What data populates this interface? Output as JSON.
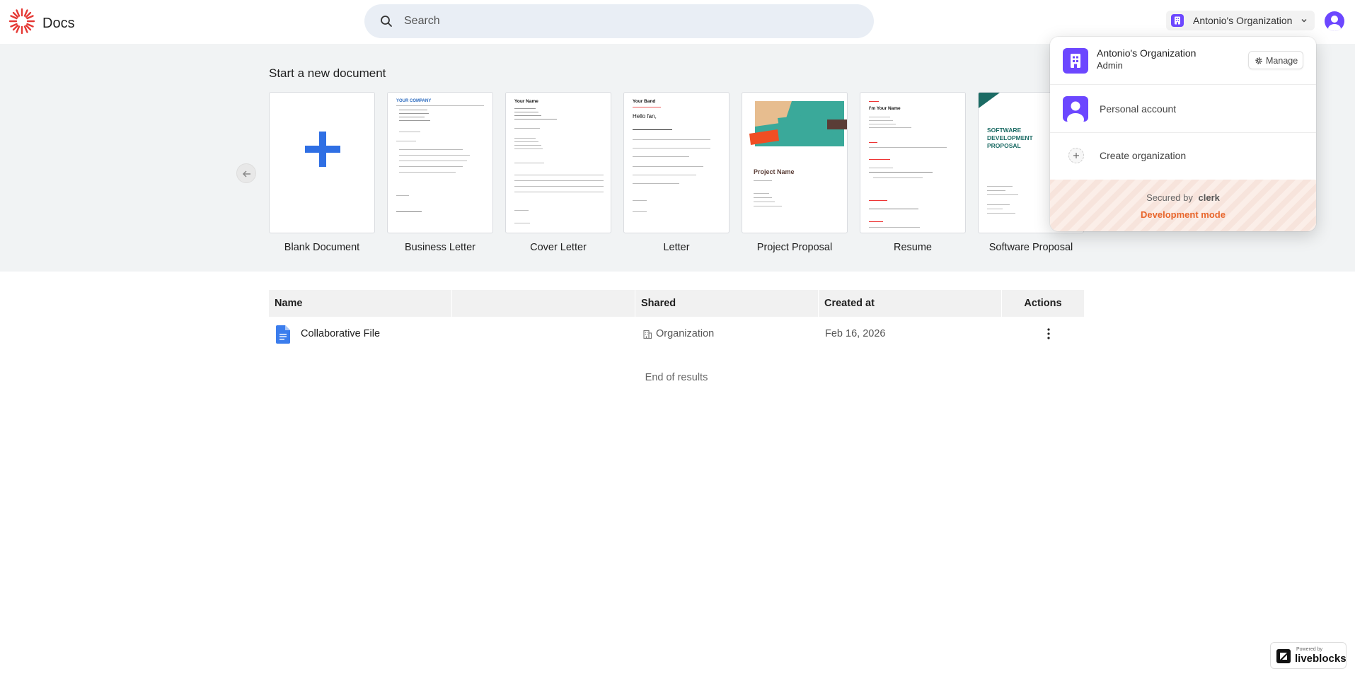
{
  "header": {
    "app_title": "Docs",
    "search_placeholder": "Search",
    "org_switcher_label": "Antonio's Organization"
  },
  "gallery": {
    "title": "Start a new document",
    "templates": [
      {
        "label": "Blank Document"
      },
      {
        "label": "Business Letter",
        "preview_heading": "YOUR COMPANY"
      },
      {
        "label": "Cover Letter",
        "preview_heading": "Your Name"
      },
      {
        "label": "Letter",
        "preview_heading": "Your Band",
        "preview_sub": "Hello fan,"
      },
      {
        "label": "Project Proposal",
        "preview_heading": "Project Name"
      },
      {
        "label": "Resume",
        "preview_heading": "I'm Your Name"
      },
      {
        "label": "Software Proposal",
        "preview_heading": "SOFTWARE DEVELOPMENT PROPOSAL"
      }
    ]
  },
  "table": {
    "columns": [
      "Name",
      "",
      "Shared",
      "Created at",
      "Actions"
    ],
    "rows": [
      {
        "name": "Collaborative File",
        "shared": "Organization",
        "created_at": "Feb 16, 2026"
      }
    ],
    "end_text": "End of results"
  },
  "popover": {
    "org_name": "Antonio's Organization",
    "org_role": "Admin",
    "manage_label": "Manage",
    "personal_label": "Personal account",
    "create_label": "Create organization",
    "secured_by": "Secured by",
    "secured_brand": "clerk",
    "dev_mode": "Development mode"
  },
  "footer": {
    "powered_by": "Powered by",
    "brand": "liveblocks"
  },
  "colors": {
    "accent_purple": "#6c47ff",
    "blank_plus_blue": "#2f6fe4",
    "dev_mode_orange": "#e8662c",
    "logo_red": "#e53935"
  }
}
